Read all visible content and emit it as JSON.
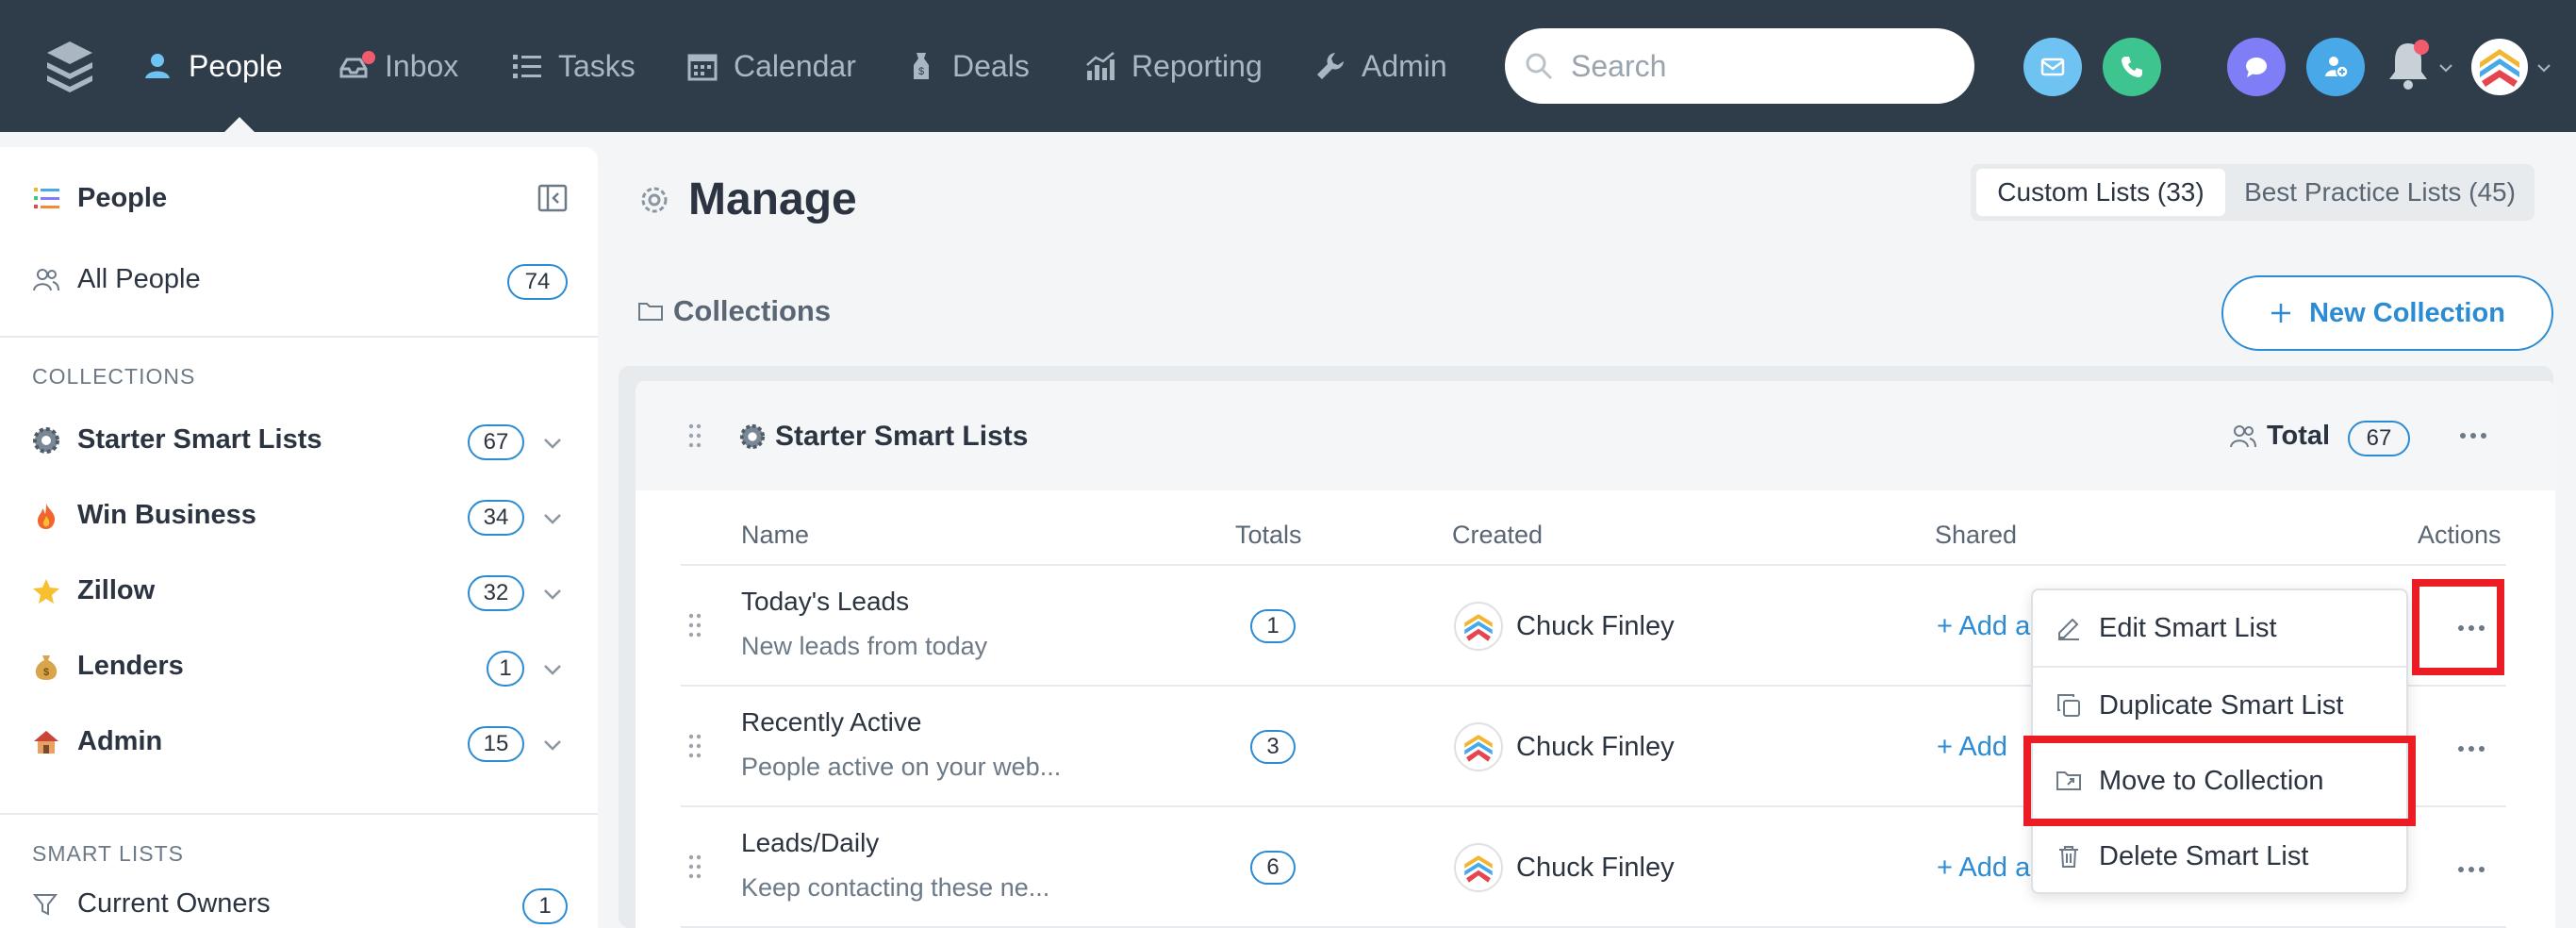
{
  "nav": {
    "items": [
      {
        "label": "People",
        "icon": "people-icon",
        "active": true
      },
      {
        "label": "Inbox",
        "icon": "inbox-icon"
      },
      {
        "label": "Tasks",
        "icon": "tasks-icon"
      },
      {
        "label": "Calendar",
        "icon": "calendar-icon"
      },
      {
        "label": "Deals",
        "icon": "deals-icon"
      },
      {
        "label": "Reporting",
        "icon": "reporting-icon"
      },
      {
        "label": "Admin",
        "icon": "wrench-icon"
      }
    ],
    "search_placeholder": "Search",
    "colors": {
      "bg": "#2f3d4b",
      "email": "#6fc3f2",
      "phone": "#3ec48e",
      "chat": "#7f7ef7",
      "add_contact": "#49a9e8"
    }
  },
  "sidebar": {
    "title": "People",
    "all_people": {
      "label": "All People",
      "count": "74"
    },
    "collections_heading": "COLLECTIONS",
    "collections": [
      {
        "label": "Starter Smart Lists",
        "count": "67",
        "icon": "gear-emoji-icon"
      },
      {
        "label": "Win Business",
        "count": "34",
        "icon": "fire-emoji-icon"
      },
      {
        "label": "Zillow",
        "count": "32",
        "icon": "star-emoji-icon"
      },
      {
        "label": "Lenders",
        "count": "1",
        "icon": "money-bag-emoji-icon"
      },
      {
        "label": "Admin",
        "count": "15",
        "icon": "house-emoji-icon"
      }
    ],
    "smart_lists_heading": "SMART LISTS",
    "smart_lists": [
      {
        "label": "Current Owners",
        "count": "1",
        "icon": "filter-icon"
      }
    ]
  },
  "main": {
    "title": "Manage",
    "tabs": [
      {
        "label": "Custom Lists (33)",
        "active": true
      },
      {
        "label": "Best Practice Lists (45)"
      }
    ],
    "collections_label": "Collections",
    "new_collection_label": "New Collection",
    "panel": {
      "title": "Starter Smart Lists",
      "total_label": "Total",
      "total_count": "67",
      "columns": [
        "Name",
        "Totals",
        "Created",
        "Shared",
        "Actions"
      ],
      "rows": [
        {
          "name": "Today's Leads",
          "description": "New leads from today",
          "total": "1",
          "created_by": "Chuck Finley",
          "shared": "Add a"
        },
        {
          "name": "Recently Active",
          "description": "People active on your web...",
          "total": "3",
          "created_by": "Chuck Finley",
          "shared": "Add"
        },
        {
          "name": "Leads/Daily",
          "description": "Keep contacting these ne...",
          "total": "6",
          "created_by": "Chuck Finley",
          "shared": "Add a"
        }
      ]
    },
    "actions_menu": [
      {
        "label": "Edit Smart List",
        "icon": "edit-icon"
      },
      {
        "label": "Duplicate Smart List",
        "icon": "duplicate-icon"
      },
      {
        "label": "Move to Collection",
        "icon": "move-folder-icon"
      },
      {
        "label": "Delete Smart List",
        "icon": "trash-icon"
      }
    ],
    "highlight_color": "#ec1c24"
  }
}
